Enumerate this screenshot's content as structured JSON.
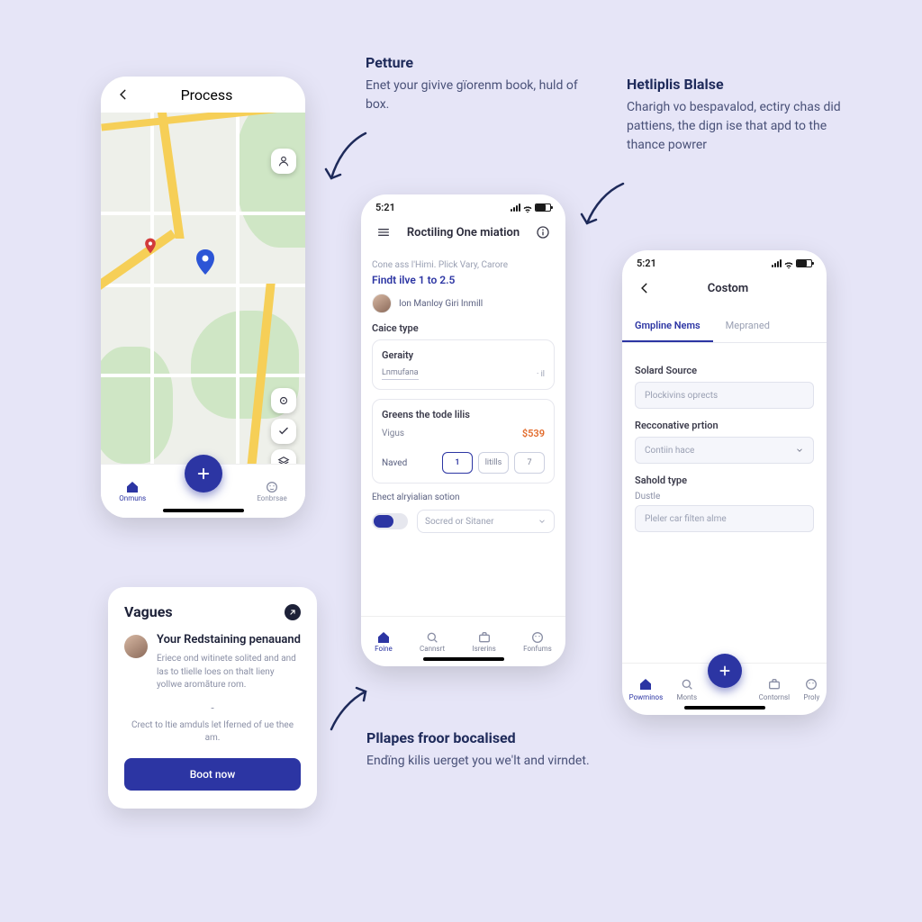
{
  "callouts": {
    "c1": {
      "title": "Petture",
      "body": "Enet your givive gïorenm book, huld of box."
    },
    "c2": {
      "title": "Hetliplis Blalse",
      "body": "Charigh vo bespavalod, ectiry chas did pattiens, the dign ise that apd to the thance powrer"
    },
    "c3": {
      "title": "Pllapes froor bocalised",
      "body": "Endïng kilis uerget you we'lt and virndet."
    }
  },
  "phone1": {
    "header_title": "Process",
    "nav": {
      "left": "Onmuns",
      "right": "Eonbrsae"
    }
  },
  "phone2": {
    "time": "5:21",
    "header_title": "Roctiling One miation",
    "crumb": "Cone ass l'Himi. Plick Vary, Carore",
    "subtitle": "Findt ilve 1 to 2.5",
    "user_name": "Ion Manloy Giri Inmill",
    "section_caice": "Caice type",
    "card1": {
      "label": "Geraity",
      "value": "Lnmufana"
    },
    "card2": {
      "label": "Greens the tode lilis",
      "subrow_label": "Vigus",
      "price": "$539",
      "naved_label": "Naved",
      "seg": [
        "1",
        "litills",
        "7"
      ]
    },
    "last_label": "Ehect alryialian sotion",
    "select_placeholder": "Socred or Sitaner",
    "tabs": [
      "Foine",
      "Cannsrt",
      "Isrerins",
      "Fonfums"
    ]
  },
  "phone3": {
    "time": "5:21",
    "header_title": "Costom",
    "tabs": {
      "a": "Gmpline Nems",
      "b": "Mepraned"
    },
    "f1_label": "Solard Source",
    "f1_placeholder": "Plockivins oprects",
    "f2_label": "Recconative prtion",
    "f2_placeholder": "Contiin hace",
    "f3_label": "Sahold type",
    "f3_sub": "Dustle",
    "f3_placeholder": "Pleler car filten alme",
    "nav": [
      "Powminos",
      "Monts",
      "",
      "Contornsl",
      "Proly"
    ]
  },
  "card": {
    "title": "Vagues",
    "item_title": "Your Redstaining penauand",
    "desc1": "Eriece ond witinete solited and and las to tlielle loes on thalt lieny yollwe aromãture rom.",
    "desc2": "Crect to ltie amduls let lferned of ue thee am.",
    "cta": "Boot now"
  }
}
